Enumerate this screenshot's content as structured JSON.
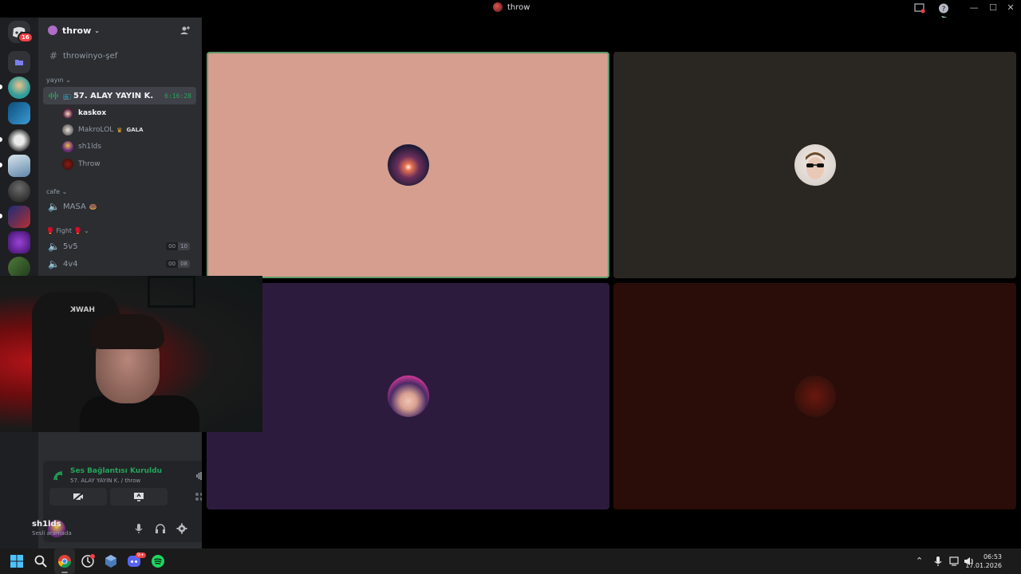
{
  "window": {
    "title": "throw",
    "controls": {
      "minimize": "—",
      "maximize": "☐",
      "close": "✕"
    }
  },
  "servers": {
    "dm_badge": "16",
    "icons": [
      "discord-home-icon",
      "folder-icon",
      "server-avatar-1",
      "server-avatar-2",
      "server-avatar-3",
      "server-avatar-4",
      "server-avatar-5",
      "server-avatar-6",
      "server-avatar-7",
      "server-avatar-8"
    ]
  },
  "guild": {
    "name": "throw",
    "chevron": "⌄",
    "invite_icon": "add-member-icon"
  },
  "channels": {
    "text_channel": {
      "symbol": "#",
      "name": "throwinyo-şef"
    },
    "category_yayin": "yayın ⌄",
    "active_voice": {
      "name": "57. ALAY YAYIN K.",
      "timer": "6:16:28"
    },
    "members": [
      {
        "name": "kaskox",
        "bold": true
      },
      {
        "name": "MakroLOL",
        "badge": "GALA"
      },
      {
        "name": "sh1lds"
      },
      {
        "name": "Throw"
      }
    ],
    "category_cafe": "cafe ⌄",
    "masa": {
      "name": "MASA"
    },
    "category_fight": "🥊 Fight 🥊 ⌄",
    "fight_channels": [
      {
        "name": "5v5",
        "left": "00",
        "right": "10"
      },
      {
        "name": "4v4",
        "left": "00",
        "right": "08"
      }
    ]
  },
  "voice_panel": {
    "status": "Ses Bağlantısı Kuruldu",
    "location": "57. ALAY YAYIN K. / throw"
  },
  "user": {
    "name": "sh1lds",
    "status": "Sesli aramada"
  },
  "taskbar": {
    "time": "06:53",
    "date": "17.01.2026",
    "discord_badge": "9+"
  },
  "colors": {
    "tile_1": "#d59e8f",
    "tile_2": "#2a2723",
    "tile_3": "#2d1b3e",
    "tile_4": "#2a0d08",
    "accent_green": "#23a55a"
  }
}
